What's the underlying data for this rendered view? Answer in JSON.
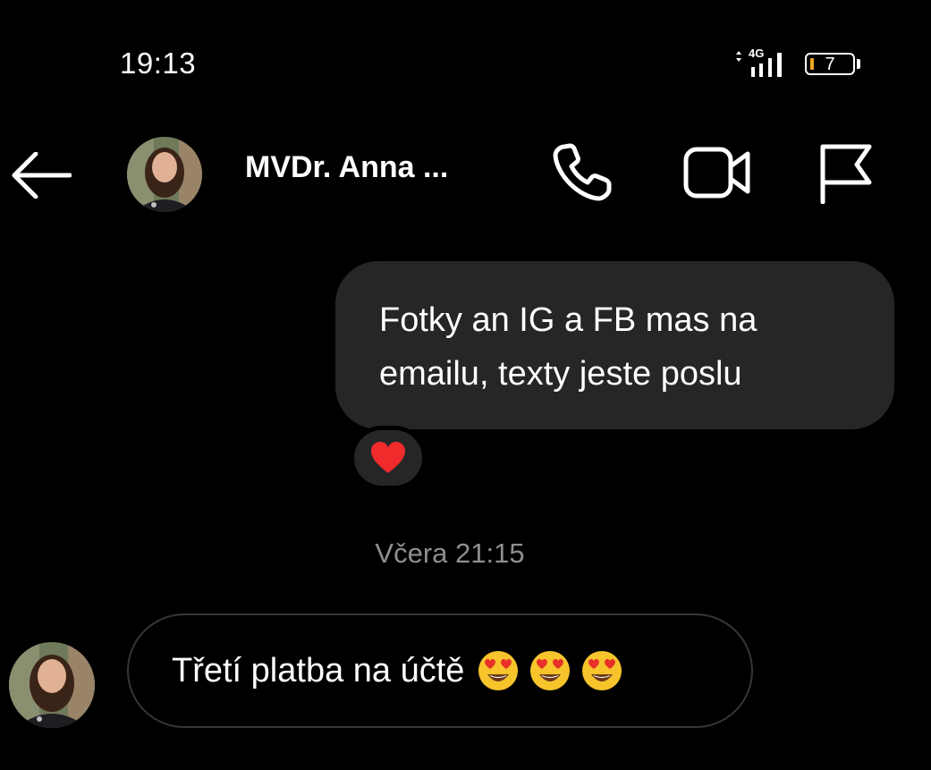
{
  "status_bar": {
    "time": "19:13",
    "network": "4G",
    "battery": "7",
    "colors": {
      "battery_low": "#f5a623"
    }
  },
  "header": {
    "back_icon": "arrow-left-icon",
    "contact_name": "MVDr. Anna ...",
    "call_icon": "phone-icon",
    "video_icon": "video-camera-icon",
    "report_icon": "flag-icon"
  },
  "messages": {
    "outgoing": {
      "text_line1": "Fotky an IG a FB mas na",
      "text_line2": "emailu, texty jeste poslu",
      "reaction": "❤"
    },
    "timestamp": "Včera 21:15",
    "incoming": {
      "text": "Třetí platba na účtě",
      "emoji_count": 3,
      "emoji_icon": "heart-eyes-emoji"
    }
  },
  "colors": {
    "background": "#000000",
    "outgoing_bubble": "#262626",
    "incoming_border": "#363636",
    "timestamp_text": "#8e8e8e",
    "reaction_heart": "#ef2b2b"
  }
}
